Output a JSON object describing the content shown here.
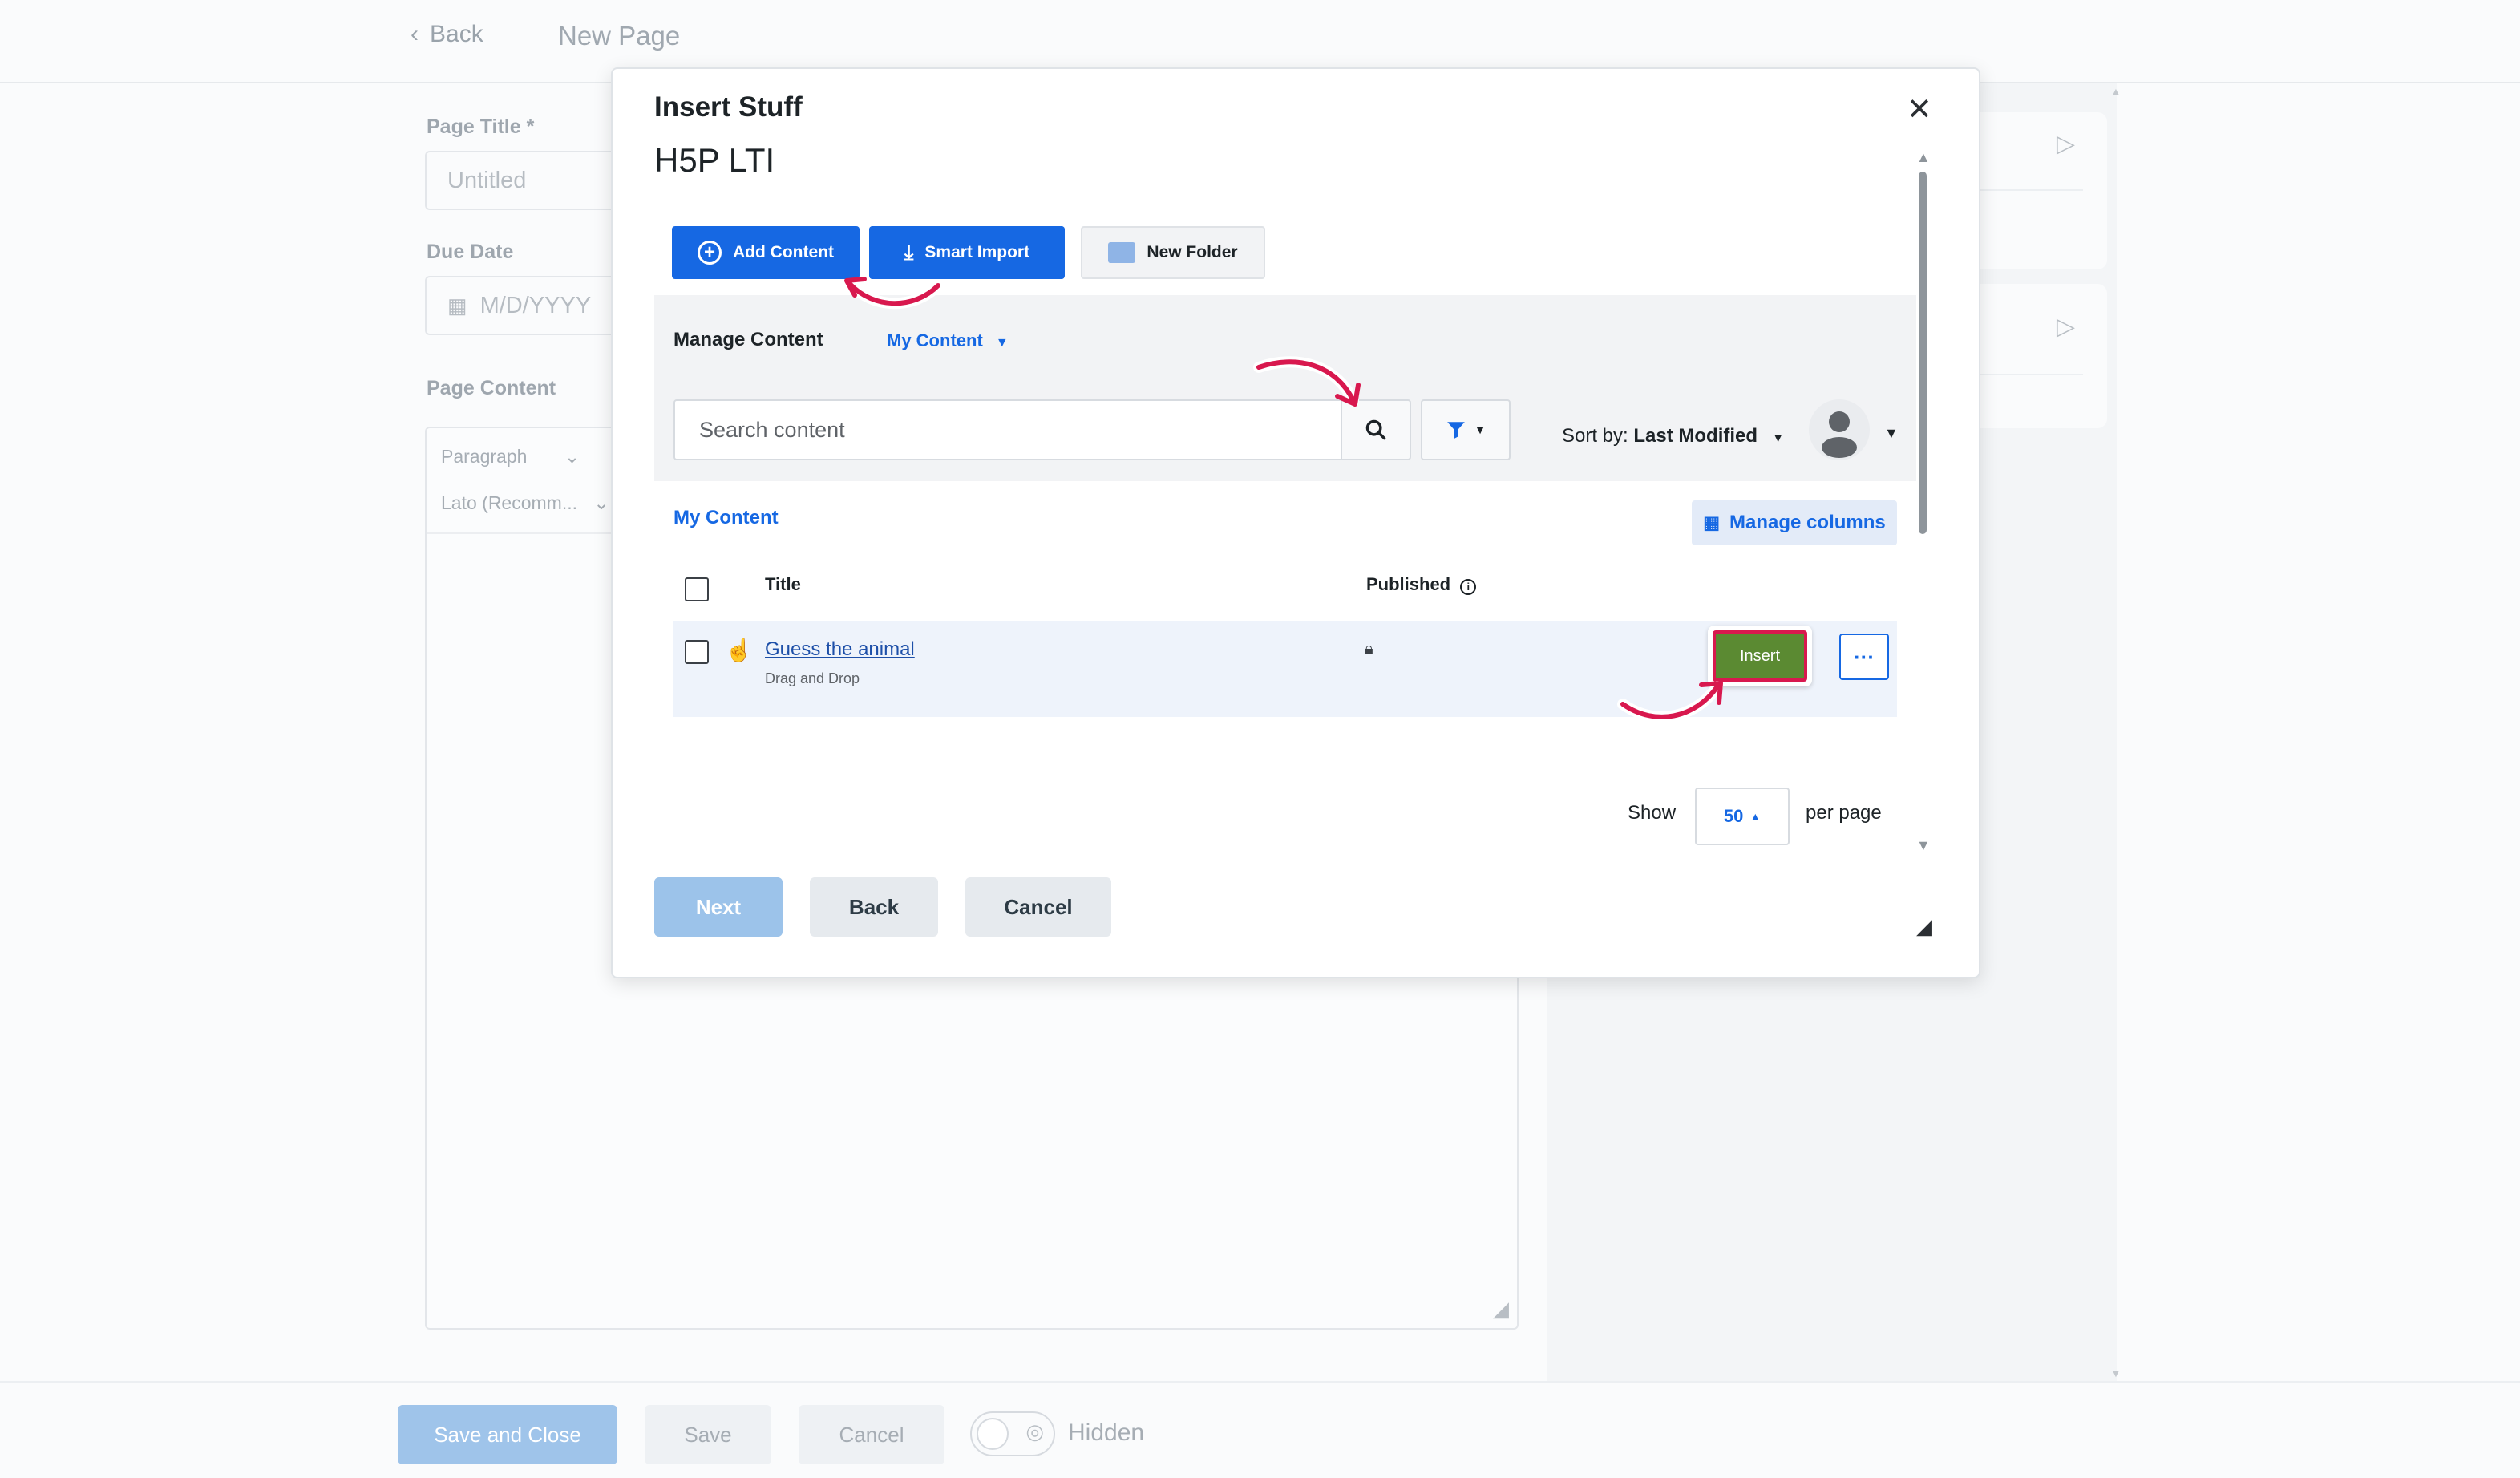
{
  "page": {
    "back_label": "Back",
    "page_name": "New Page",
    "title_label": "Page Title *",
    "title_placeholder": "Untitled",
    "due_label": "Due Date",
    "due_placeholder": "M/D/YYYY",
    "content_label": "Page Content",
    "editor": {
      "block_style": "Paragraph",
      "font": "Lato (Recomm..."
    }
  },
  "footer": {
    "save_close": "Save and Close",
    "save": "Save",
    "cancel": "Cancel",
    "hidden_label": "Hidden"
  },
  "modal": {
    "title": "Insert Stuff",
    "tool_name": "H5P LTI",
    "buttons": {
      "next": "Next",
      "back": "Back",
      "cancel": "Cancel"
    }
  },
  "h5p": {
    "toolbar": {
      "add_content": "Add Content",
      "smart_import": "Smart Import",
      "new_folder": "New Folder"
    },
    "manage_content": "Manage Content",
    "content_filter": "My Content",
    "search_placeholder": "Search content",
    "sort_prefix": "Sort by:",
    "sort_value": "Last Modified",
    "section_title": "My Content",
    "manage_columns": "Manage columns",
    "columns": {
      "title": "Title",
      "published": "Published"
    },
    "rows": [
      {
        "title": "Guess the animal",
        "type": "Drag and Drop",
        "insert": "Insert"
      }
    ],
    "pagination": {
      "show": "Show",
      "per_page_value": "50",
      "per_page": "per page"
    }
  },
  "colors": {
    "primary_blue": "#1668e3",
    "insert_green": "#5b8a32",
    "annotation_pink": "#d8184e"
  }
}
